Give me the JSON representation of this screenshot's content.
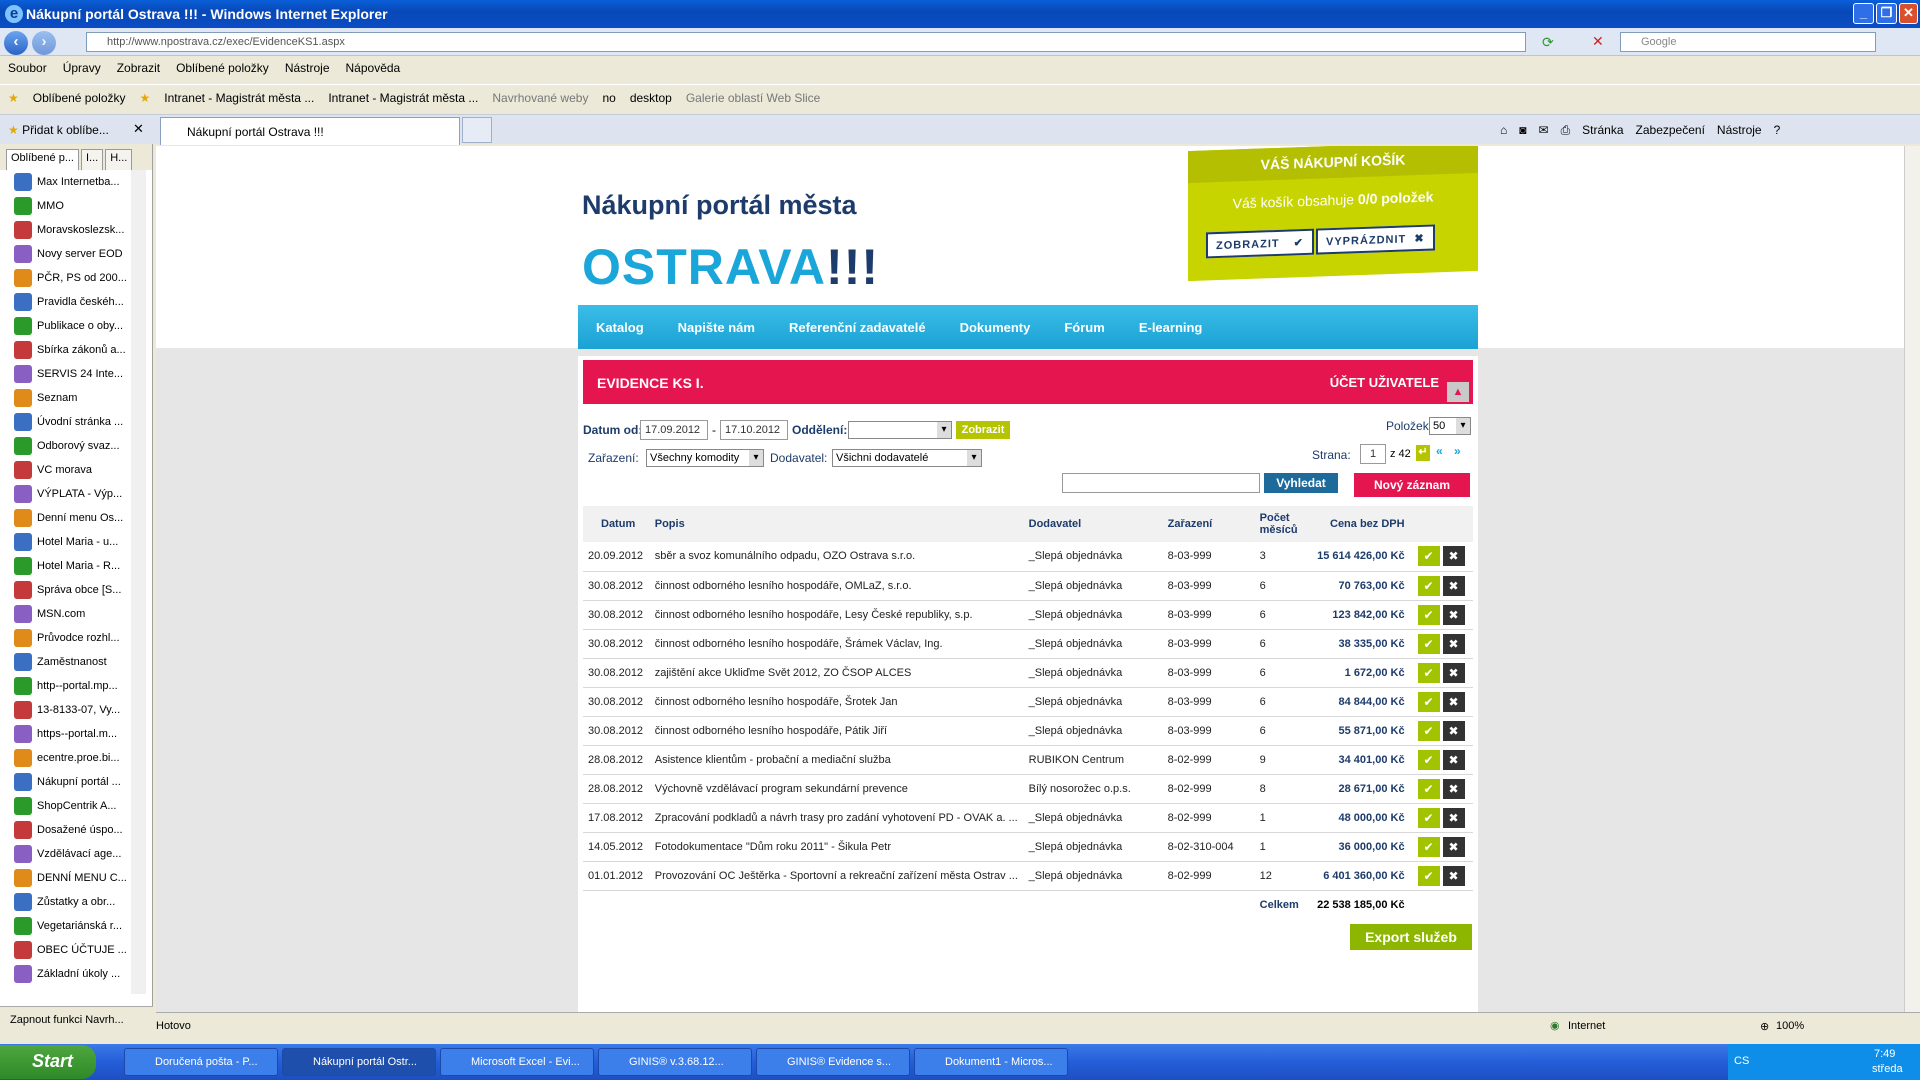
{
  "window": {
    "title": "Nákupní portál Ostrava !!! - Windows Internet Explorer"
  },
  "address": {
    "url": "http://www.npostrava.cz/exec/EvidenceKS1.aspx",
    "search_placeholder": "Google"
  },
  "menu": [
    "Soubor",
    "Úpravy",
    "Zobrazit",
    "Oblíbené položky",
    "Nástroje",
    "Nápověda"
  ],
  "favbar": {
    "label": "Oblíbené položky",
    "items": [
      "Intranet - Magistrát města ...",
      "Intranet - Magistrát města ...",
      "Navrhované weby",
      "no",
      "desktop",
      "Galerie oblastí Web Slice"
    ]
  },
  "tab": {
    "add_label": "Přidat k oblíbe...",
    "title": "Nákupní portál Ostrava !!!"
  },
  "toolbar": [
    "Stránka",
    "Zabezpečení",
    "Nástroje"
  ],
  "sidebar": {
    "tabs": [
      "Oblíbené p...",
      "I...",
      "H..."
    ],
    "items": [
      "Max Internetba...",
      "MMO",
      "Moravskoslezsk...",
      "Novy server EOD",
      "PČR, PS od 200...",
      "Pravidla českéh...",
      "Publikace o oby...",
      "Sbírka zákonů a...",
      "SERVIS 24 Inte...",
      "Seznam",
      "Úvodní stránka ...",
      "Odborový svaz...",
      "VC morava",
      "VÝPLATA - Výp...",
      "Denní menu Os...",
      "Hotel Maria - u...",
      "Hotel Maria - R...",
      "Správa obce [S...",
      "MSN.com",
      "Průvodce rozhl...",
      "Zaměstnanost",
      "http--portal.mp...",
      "13-8133-07, Vy...",
      "https--portal.m...",
      "ecentre.proe.bi...",
      "Nákupní portál ...",
      "ShopCentrik  A...",
      "Dosažené úspo...",
      "Vzdělávací age...",
      "DENNÍ MENU C...",
      "Zůstatky a obr...",
      "Vegetariánská r...",
      "OBEC ÚČTUJE ...",
      "Základní úkoly ..."
    ],
    "bottom": "Zapnout funkci Navrh..."
  },
  "site": {
    "brand_line1": "Nákupní portál města",
    "brand_city": "OSTRAVA",
    "brand_excl": "!!!",
    "cart_title": "VÁŠ NÁKUPNÍ KOŠÍK",
    "cart_msg_prefix": "Váš košík obsahuje ",
    "cart_msg_count": "0/0 položek",
    "cart_show": "ZOBRAZIT",
    "cart_empty": "VYPRÁZDNIT",
    "nav": [
      "Katalog",
      "Napište nám",
      "Referenční zadavatelé",
      "Dokumenty",
      "Fórum",
      "E-learning"
    ]
  },
  "panel": {
    "title": "EVIDENCE KS I.",
    "account": "ÚČET UŽIVATELE",
    "date_from_label": "Datum od:",
    "date_from": "17.09.2012",
    "dash": "-",
    "date_to": "17.10.2012",
    "dept_label": "Oddělení:",
    "show_btn": "Zobrazit",
    "items_label": "Položek",
    "items_value": "50",
    "class_label": "Zařazení:",
    "class_value": "Všechny komodity",
    "supplier_label": "Dodavatel:",
    "supplier_value": "Všichni dodavatelé",
    "page_label": "Strana:",
    "page_value": "1",
    "page_of": "z 42",
    "search_btn": "Vyhledat",
    "new_btn": "Nový záznam",
    "columns": [
      "Datum",
      "Popis",
      "Dodavatel",
      "Zařazení",
      "Počet měsíců",
      "Cena bez DPH"
    ],
    "rows": [
      [
        "20.09.2012",
        "sběr a svoz komunálního odpadu, OZO Ostrava s.r.o.",
        "_Slepá objednávka",
        "8-03-999",
        "3",
        "15 614 426,00 Kč"
      ],
      [
        "30.08.2012",
        "činnost odborného lesního hospodáře, OMLaZ, s.r.o.",
        "_Slepá objednávka",
        "8-03-999",
        "6",
        "70 763,00 Kč"
      ],
      [
        "30.08.2012",
        "činnost odborného lesního hospodáře, Lesy České republiky, s.p.",
        "_Slepá objednávka",
        "8-03-999",
        "6",
        "123 842,00 Kč"
      ],
      [
        "30.08.2012",
        "činnost odborného lesního hospodáře, Šrámek Václav, Ing.",
        "_Slepá objednávka",
        "8-03-999",
        "6",
        "38 335,00 Kč"
      ],
      [
        "30.08.2012",
        "zajištění akce Ukliďme Svět 2012, ZO ČSOP ALCES",
        "_Slepá objednávka",
        "8-03-999",
        "6",
        "1 672,00 Kč"
      ],
      [
        "30.08.2012",
        "činnost odborného lesního hospodáře, Šrotek Jan",
        "_Slepá objednávka",
        "8-03-999",
        "6",
        "84 844,00 Kč"
      ],
      [
        "30.08.2012",
        "činnost odborného lesního hospodáře, Pátik Jiří",
        "_Slepá objednávka",
        "8-03-999",
        "6",
        "55 871,00 Kč"
      ],
      [
        "28.08.2012",
        "Asistence klientům - probační a mediační služba",
        "RUBIKON Centrum",
        "8-02-999",
        "9",
        "34 401,00 Kč"
      ],
      [
        "28.08.2012",
        "Výchovně vzdělávací program sekundární prevence",
        "Bílý nosorožec o.p.s.",
        "8-02-999",
        "8",
        "28 671,00 Kč"
      ],
      [
        "17.08.2012",
        "Zpracování podkladů a návrh trasy pro zadání vyhotovení PD - OVAK a. ...",
        "_Slepá objednávka",
        "8-02-999",
        "1",
        "48 000,00 Kč"
      ],
      [
        "14.05.2012",
        "Fotodokumentace \"Dům roku 2011\" - Šikula Petr",
        "_Slepá objednávka",
        "8-02-310-004",
        "1",
        "36 000,00 Kč"
      ],
      [
        "01.01.2012",
        "Provozování OC Ještěrka - Sportovní a rekreační zařízení města Ostrav ...",
        "_Slepá objednávka",
        "8-02-999",
        "12",
        "6 401 360,00 Kč"
      ]
    ],
    "total_label": "Celkem",
    "total_value": "22 538 185,00 Kč",
    "export_btn": "Export služeb"
  },
  "status": {
    "left": "Hotovo",
    "zone": "Internet",
    "zoom": "100%"
  },
  "taskbar": {
    "start": "Start",
    "tasks": [
      "Doručená pošta - P...",
      "Nákupní portál Ostr...",
      "Microsoft Excel - Evi...",
      "GINIS®  v.3.68.12...",
      "GINIS® Evidence s...",
      "Dokument1 - Micros..."
    ],
    "lang": "CS",
    "time": "7:49",
    "day": "středa"
  },
  "colors": {
    "accent_blue": "#1ba6d9",
    "brand_navy": "#1d3b6b",
    "red": "#e5154f",
    "lime": "#c8d400"
  }
}
